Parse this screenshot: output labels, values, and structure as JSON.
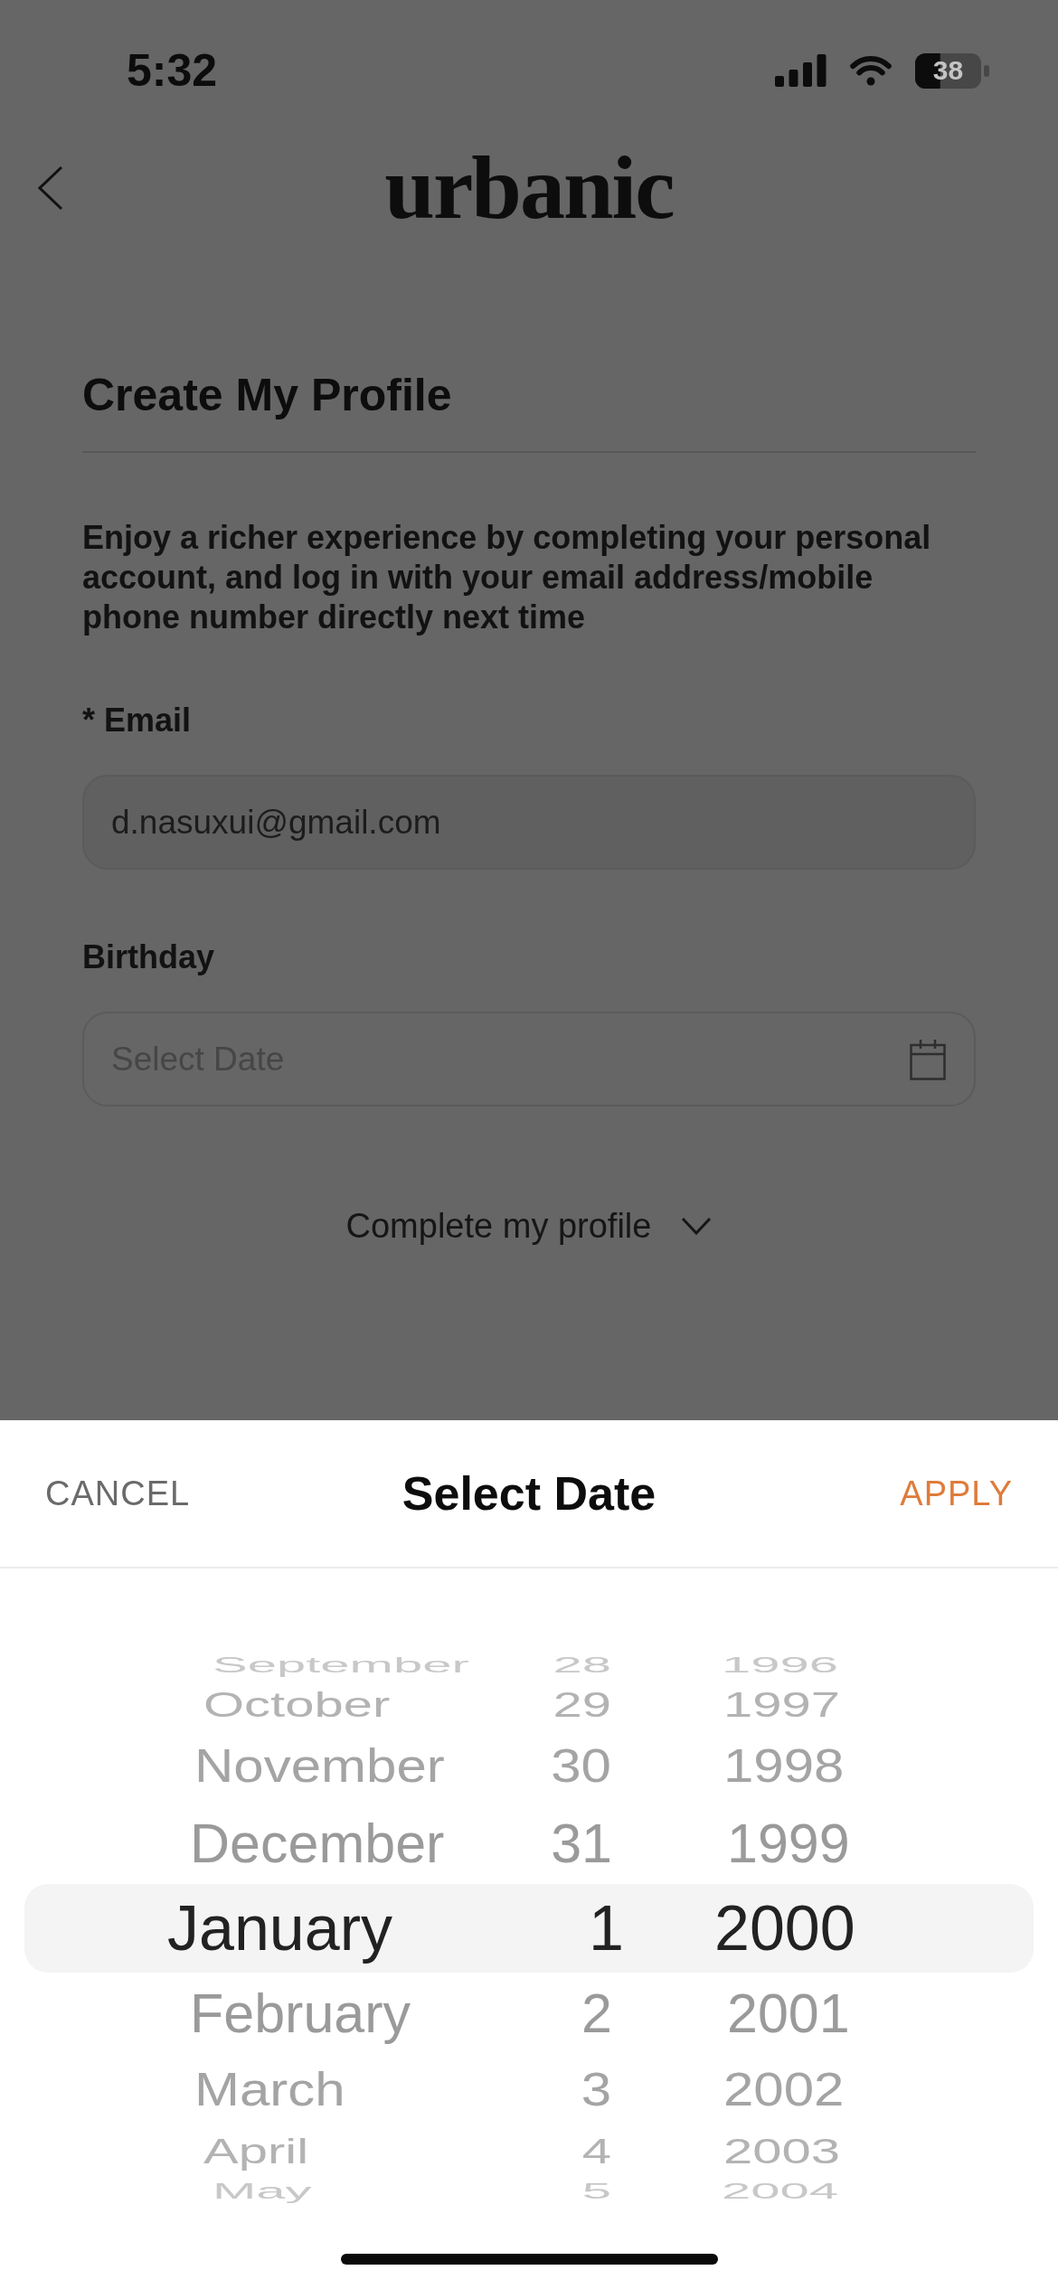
{
  "status_bar": {
    "time": "5:32",
    "battery": "38"
  },
  "header": {
    "logo": "urbanic"
  },
  "form": {
    "title": "Create My Profile",
    "intro": "Enjoy a richer experience by completing your personal account, and log in with your email address/mobile phone number directly next time",
    "fields": [
      {
        "kind": "text",
        "label": "* Email",
        "value": "d.nasuxui@gmail.com"
      },
      {
        "kind": "date",
        "label": "Birthday",
        "placeholder": "Select Date"
      }
    ],
    "more": {
      "label": "Complete my profile",
      "expanded": false
    }
  },
  "date_sheet": {
    "cancel": "CANCEL",
    "title": "Select Date",
    "apply": "APPLY",
    "rows": [
      {
        "month": "September",
        "day": "28",
        "year": "1996",
        "selected": false
      },
      {
        "month": "October",
        "day": "29",
        "year": "1997",
        "selected": false
      },
      {
        "month": "November",
        "day": "30",
        "year": "1998",
        "selected": false
      },
      {
        "month": "December",
        "day": "31",
        "year": "1999",
        "selected": false
      },
      {
        "month": "January",
        "day": "1",
        "year": "2000",
        "selected": true
      },
      {
        "month": "February",
        "day": "2",
        "year": "2001",
        "selected": false
      },
      {
        "month": "March",
        "day": "3",
        "year": "2002",
        "selected": false
      },
      {
        "month": "April",
        "day": "4",
        "year": "2003",
        "selected": false
      },
      {
        "month": "May",
        "day": "5",
        "year": "2004",
        "selected": false
      }
    ]
  }
}
